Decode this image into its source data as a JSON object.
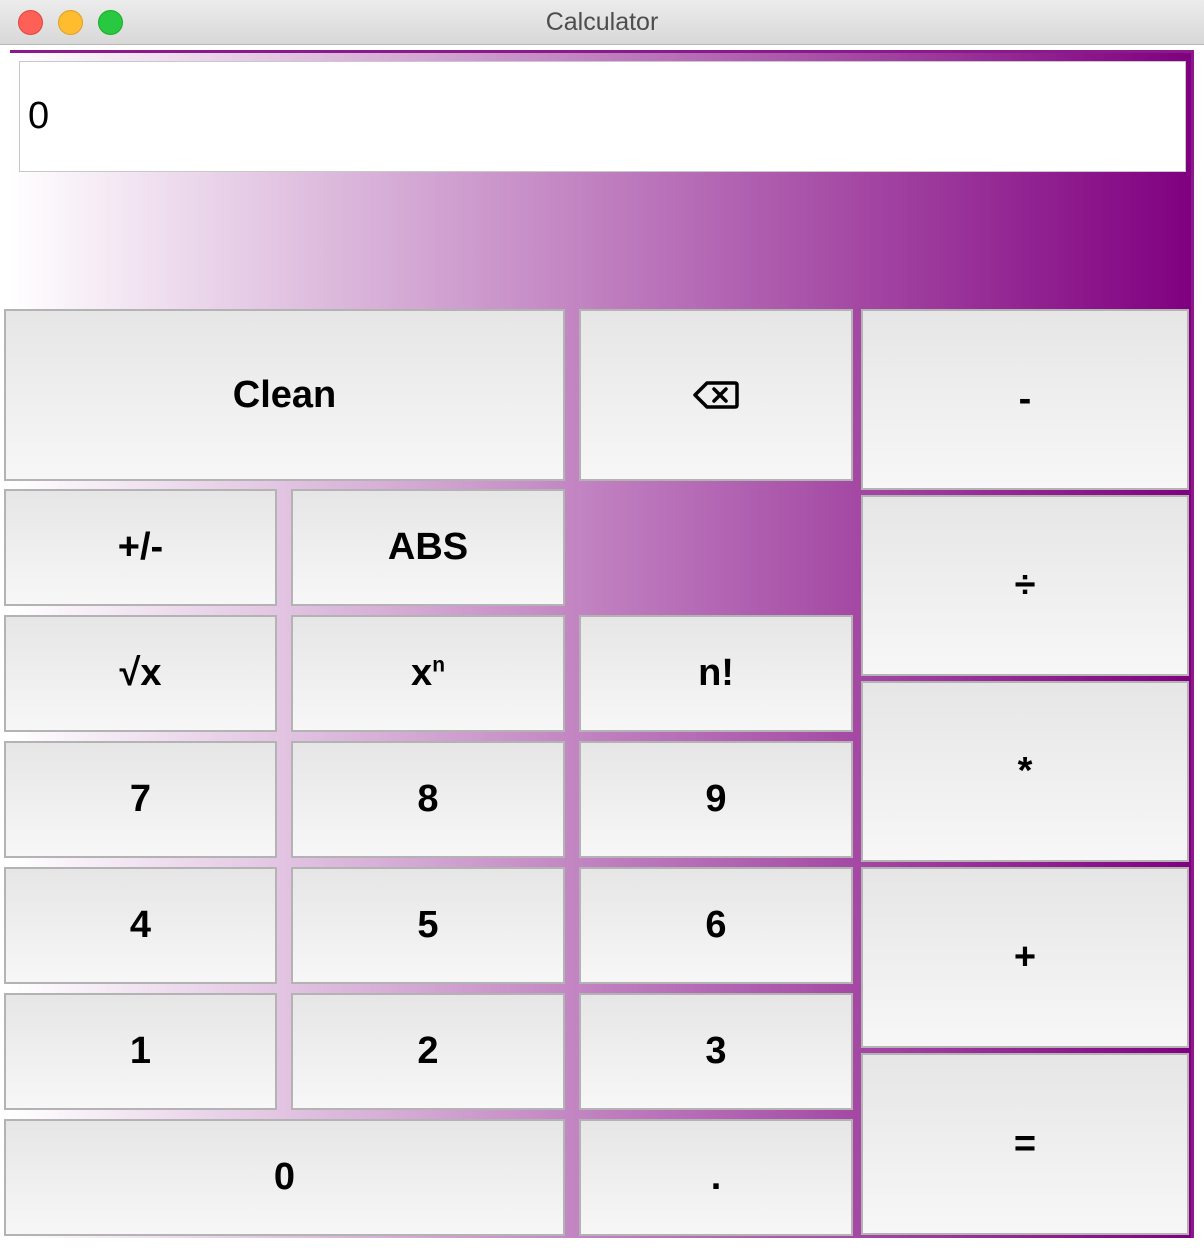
{
  "window": {
    "title": "Calculator"
  },
  "display": {
    "value": "0"
  },
  "buttons": {
    "clean": "Clean",
    "backspace_icon": "backspace-icon",
    "minus": "-",
    "plus_minus": "+/-",
    "abs": "ABS",
    "divide": "÷",
    "sqrt": "√x",
    "power_base": "x",
    "power_exp": "n",
    "factorial": "n!",
    "multiply": "*",
    "seven": "7",
    "eight": "8",
    "nine": "9",
    "four": "4",
    "five": "5",
    "six": "6",
    "plus": "+",
    "one": "1",
    "two": "2",
    "three": "3",
    "equals": "=",
    "zero": "0",
    "decimal": "."
  },
  "colors": {
    "gradient_start": "#ffffff",
    "gradient_end": "#800080",
    "close": "#fe5f57",
    "minimize": "#febc2e",
    "maximize": "#28c840"
  }
}
